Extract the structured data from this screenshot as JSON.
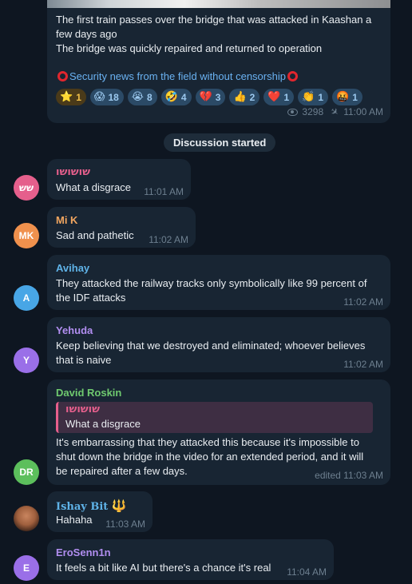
{
  "channel_post": {
    "text_lines": [
      "The first train passes over the bridge that was attacked in Kaashan a",
      "few days ago",
      "The bridge was quickly repaired and returned to operation"
    ],
    "link_text": "Security news from the field without censorship",
    "reactions": [
      {
        "emoji": "⭐",
        "count": "1",
        "highlighted": true
      },
      {
        "emoji": "😱",
        "count": "18"
      },
      {
        "emoji": "😭",
        "count": "8"
      },
      {
        "emoji": "🤣",
        "count": "4"
      },
      {
        "emoji": "💔",
        "count": "3"
      },
      {
        "emoji": "👍",
        "count": "2"
      },
      {
        "emoji": "❤️",
        "count": "1"
      },
      {
        "emoji": "👏",
        "count": "1"
      },
      {
        "emoji": "🤬",
        "count": "1"
      }
    ],
    "views": "3298",
    "time": "11:00 AM"
  },
  "service_message": "Discussion started",
  "comments": [
    {
      "author": "שושושו",
      "initials": "שש",
      "text": [
        "What a disgrace"
      ],
      "time": "11:01 AM",
      "name_color": "#e55f8c",
      "avatar_color": "#e55f8c"
    },
    {
      "author": "Mi K",
      "initials": "MK",
      "text": [
        "Sad and pathetic"
      ],
      "time": "11:02 AM",
      "name_color": "#f2a660",
      "avatar_color": "#f0914d"
    },
    {
      "author": "Avihay",
      "initials": "A",
      "text": [
        "They attacked the railway tracks only symbolically like 99 percent of",
        "the IDF attacks"
      ],
      "time": "11:02 AM",
      "name_color": "#5fb3e8",
      "avatar_color": "#48a6e6"
    },
    {
      "author": "Yehuda",
      "initials": "Y",
      "text": [
        "Keep believing that we destroyed and eliminated; whoever believes",
        "that is naive"
      ],
      "time": "11:02 AM",
      "name_color": "#b18ef0",
      "avatar_color": "#9a6fe8"
    },
    {
      "author": "David Roskin",
      "initials": "DR",
      "reply_author": "שושושו",
      "reply_text": "What a disgrace",
      "text": [
        "It's embarrassing that they attacked this because it's impossible to",
        "shut down the bridge in the video for an extended period, and it will",
        "be repaired after a few days."
      ],
      "time": "edited 11:03 AM",
      "name_color": "#6fca6f",
      "avatar_color": "#5cbf5c"
    },
    {
      "author": "Ishay Bit",
      "author_badge": "🔱",
      "text": [
        "Hahaha"
      ],
      "time": "11:03 AM",
      "name_color": "#5fb3e8",
      "avatar_color": "#8a5a3c"
    },
    {
      "author": "EroSenn1n",
      "initials": "E",
      "text": [
        "It feels a bit like AI but there's a chance it's real"
      ],
      "time": "11:04 AM",
      "name_color": "#b18ef0",
      "avatar_color": "#9a6fe8"
    }
  ]
}
